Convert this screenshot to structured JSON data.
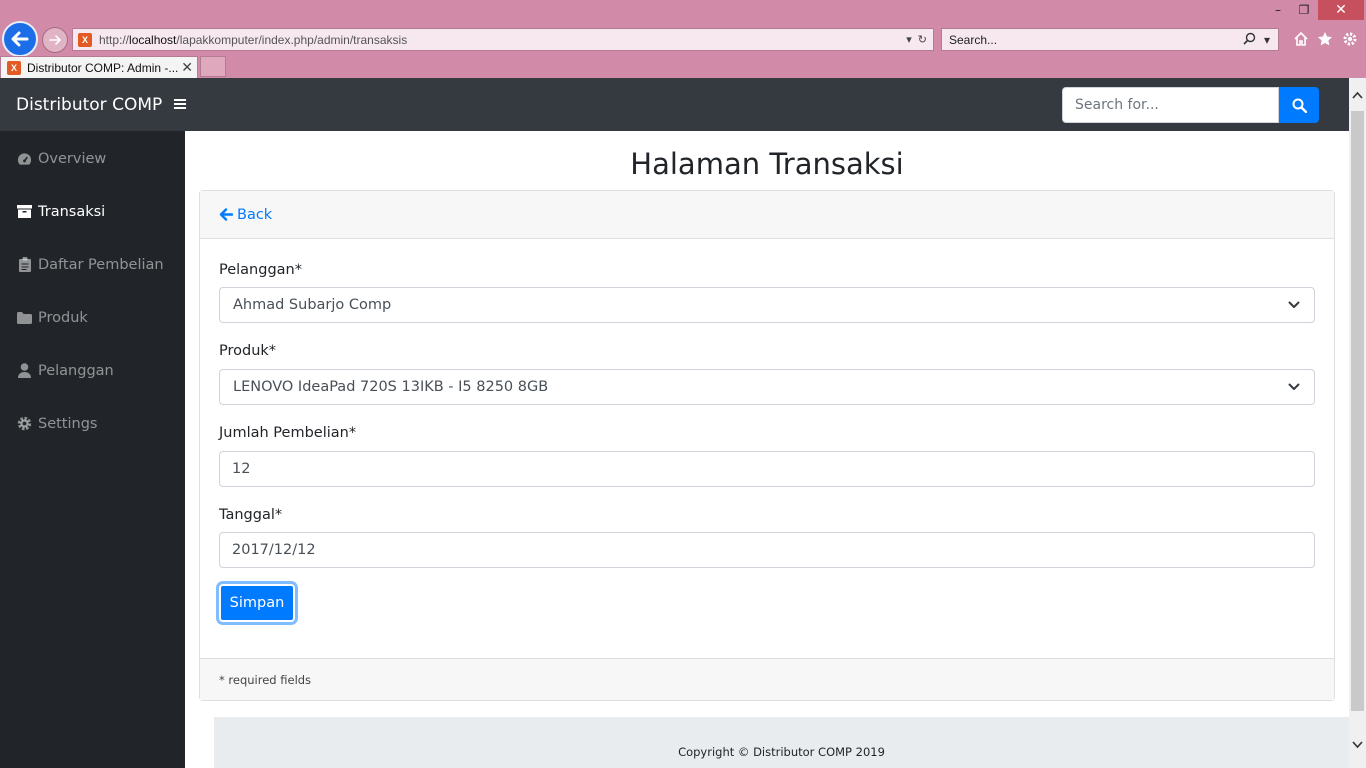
{
  "browser": {
    "url_prefix": "http://",
    "url_host": "localhost",
    "url_path": "/lapakkomputer/index.php/admin/transaksis",
    "search_placeholder": "Search...",
    "tab_title": "Distributor COMP: Admin -...",
    "favicon_text": "X",
    "window_controls": {
      "minimize": "–",
      "maximize": "❐",
      "close": "✕"
    },
    "toolbar_icons": [
      "home-icon",
      "star-icon",
      "gear-icon"
    ]
  },
  "topnav": {
    "brand": "Distributor COMP",
    "search_placeholder": "Search for..."
  },
  "sidebar": {
    "items": [
      {
        "label": "Overview",
        "icon": "tachometer-icon",
        "active": false
      },
      {
        "label": "Transaksi",
        "icon": "archive-icon",
        "active": true
      },
      {
        "label": "Daftar Pembelian",
        "icon": "clipboard-icon",
        "active": false
      },
      {
        "label": "Produk",
        "icon": "folder-icon",
        "active": false
      },
      {
        "label": "Pelanggan",
        "icon": "user-icon",
        "active": false
      },
      {
        "label": "Settings",
        "icon": "cog-icon",
        "active": false
      }
    ]
  },
  "main": {
    "title": "Halaman Transaksi",
    "back_label": "Back",
    "form": {
      "pelanggan": {
        "label": "Pelanggan*",
        "value": "Ahmad Subarjo Comp"
      },
      "produk": {
        "label": "Produk*",
        "value": "LENOVO IdeaPad 720S 13IKB - I5 8250 8GB"
      },
      "jumlah": {
        "label": "Jumlah Pembelian*",
        "value": "12"
      },
      "tanggal": {
        "label": "Tanggal*",
        "value": "2017/12/12"
      },
      "submit_label": "Simpan"
    },
    "footer_note": "* required fields"
  },
  "footer": {
    "copyright": "Copyright © Distributor COMP 2019"
  },
  "colors": {
    "primary": "#007bff",
    "sidebar_bg": "#212529",
    "topnav_bg": "#343a40",
    "chrome_bg": "#d18aa7"
  }
}
